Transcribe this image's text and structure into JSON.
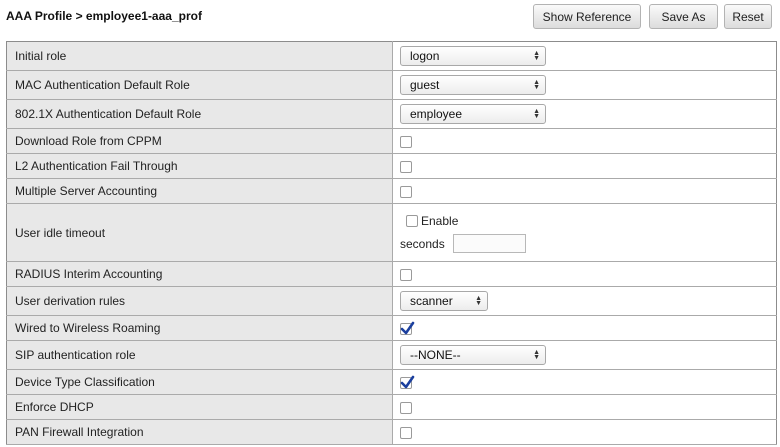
{
  "header": {
    "title": "AAA Profile > employee1-aaa_prof",
    "buttons": {
      "show_reference": "Show Reference",
      "save_as": "Save As",
      "reset": "Reset"
    }
  },
  "rows": [
    {
      "label": "Initial role",
      "type": "select",
      "value": "logon"
    },
    {
      "label": "MAC Authentication Default Role",
      "type": "select",
      "value": "guest"
    },
    {
      "label": "802.1X Authentication Default Role",
      "type": "select",
      "value": "employee"
    },
    {
      "label": "Download Role from CPPM",
      "type": "checkbox",
      "checked": false
    },
    {
      "label": "L2 Authentication Fail Through",
      "type": "checkbox",
      "checked": false
    },
    {
      "label": "Multiple Server Accounting",
      "type": "checkbox",
      "checked": false
    },
    {
      "label": "User idle timeout",
      "type": "idle",
      "enable_label": "Enable",
      "enable_checked": false,
      "unit": "seconds",
      "value": ""
    },
    {
      "label": "RADIUS Interim Accounting",
      "type": "checkbox",
      "checked": false
    },
    {
      "label": "User derivation rules",
      "type": "select",
      "value": "scanner"
    },
    {
      "label": "Wired to Wireless Roaming",
      "type": "checkbox",
      "checked": true
    },
    {
      "label": "SIP authentication role",
      "type": "select",
      "value": "--NONE--"
    },
    {
      "label": "Device Type Classification",
      "type": "checkbox",
      "checked": true
    },
    {
      "label": "Enforce DHCP",
      "type": "checkbox",
      "checked": false
    },
    {
      "label": "PAN Firewall Integration",
      "type": "checkbox",
      "checked": false
    }
  ],
  "colors": {
    "label_bg": "#e8e8e8",
    "check_mark": "#1b3f9e",
    "border": "#8c8c8c"
  }
}
